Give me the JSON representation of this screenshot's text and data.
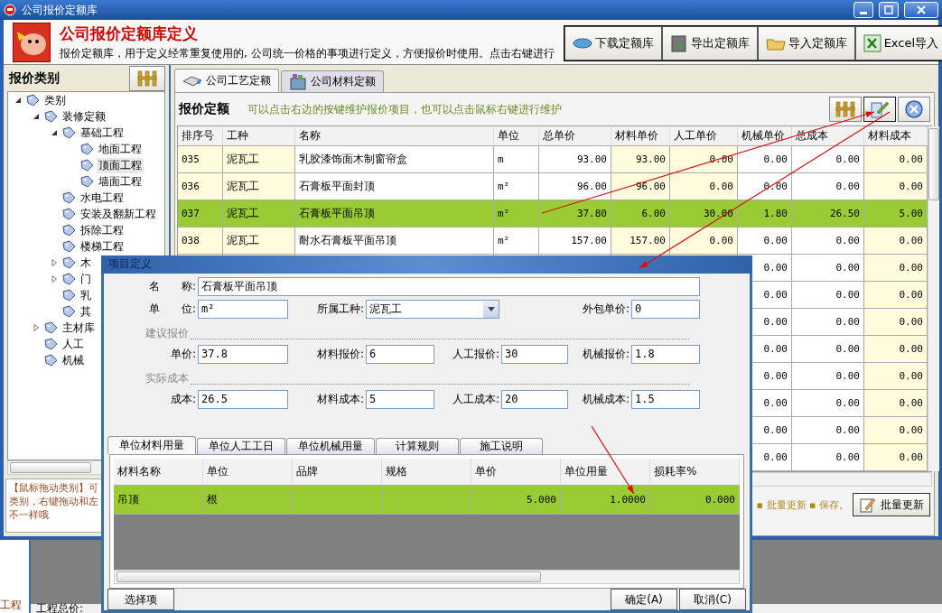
{
  "window": {
    "title": "公司报价定额库"
  },
  "header": {
    "title": "公司报价定额库定义",
    "description": "报价定额库，用于定义经常重复使用的, 公司统一价格的事项进行定义，方便报价时使用。点击右键进行",
    "buttons": [
      {
        "label": "下载定额库",
        "kind": "download"
      },
      {
        "label": "导出定额库",
        "kind": "export"
      },
      {
        "label": "导入定额库",
        "kind": "import"
      },
      {
        "label": "Excel导入",
        "kind": "excel"
      }
    ]
  },
  "sidebar": {
    "title": "报价类别",
    "tree": [
      {
        "label": "类别",
        "expanded": true,
        "selected": false,
        "children": [
          {
            "label": "装修定额",
            "expanded": true,
            "selected": false,
            "children": [
              {
                "label": "基础工程",
                "expanded": true,
                "selected": false,
                "children": [
                  {
                    "label": "地面工程",
                    "selected": false
                  },
                  {
                    "label": "顶面工程",
                    "selected": true
                  },
                  {
                    "label": "墙面工程",
                    "selected": false
                  }
                ]
              },
              {
                "label": "水电工程",
                "selected": false
              },
              {
                "label": "安装及翻新工程",
                "selected": false
              },
              {
                "label": "拆除工程",
                "selected": false
              },
              {
                "label": "楼梯工程",
                "selected": false
              },
              {
                "label": "木",
                "expanded": false,
                "selected": false
              },
              {
                "label": "门",
                "expanded": false,
                "selected": false
              },
              {
                "label": "乳",
                "selected": false
              },
              {
                "label": "其",
                "selected": false
              }
            ]
          },
          {
            "label": "主材库",
            "expanded": false,
            "selected": false
          },
          {
            "label": "人工",
            "selected": false
          },
          {
            "label": "机械",
            "selected": false
          }
        ]
      }
    ],
    "hint_lines": [
      "【鼠标拖动类别】可",
      "类别，右键拖动和左",
      "不一样哦"
    ]
  },
  "tabs": [
    {
      "label": "公司工艺定额",
      "selected": true,
      "kind": "process"
    },
    {
      "label": "公司材料定额",
      "selected": false,
      "kind": "material"
    }
  ],
  "panel": {
    "title": "报价定额",
    "hint": "可以点击右边的按键维护报价项目，也可以点击鼠标右键进行维护",
    "columns": [
      {
        "label": "排序号",
        "shaded": true
      },
      {
        "label": "工种",
        "shaded": true
      },
      {
        "label": "名称",
        "shaded": false
      },
      {
        "label": "单位",
        "shaded": false
      },
      {
        "label": "总单价",
        "shaded": false
      },
      {
        "label": "材料单价",
        "shaded": true
      },
      {
        "label": "人工单价",
        "shaded": true
      },
      {
        "label": "机械单价",
        "shaded": false
      },
      {
        "label": "总成本",
        "shaded": false
      },
      {
        "label": "材料成本",
        "shaded": true
      }
    ],
    "rows": [
      {
        "selected": false,
        "cells": [
          "035",
          "泥瓦工",
          "乳胶漆饰面木制窗帘盒",
          "m",
          "93.00",
          "93.00",
          "0.00",
          "0.00",
          "0.00",
          "0.00"
        ]
      },
      {
        "selected": false,
        "cells": [
          "036",
          "泥瓦工",
          "石膏板平面封顶",
          "m²",
          "96.00",
          "96.00",
          "0.00",
          "0.00",
          "0.00",
          "0.00"
        ]
      },
      {
        "selected": true,
        "cells": [
          "037",
          "泥瓦工",
          "石膏板平面吊顶",
          "m²",
          "37.80",
          "6.00",
          "30.00",
          "1.80",
          "26.50",
          "5.00"
        ]
      },
      {
        "selected": false,
        "cells": [
          "038",
          "泥瓦工",
          "耐水石膏板平面吊顶",
          "m²",
          "157.00",
          "157.00",
          "0.00",
          "0.00",
          "0.00",
          "0.00"
        ]
      }
    ],
    "partially_covered_rows": [
      [
        "0.00",
        "0.00",
        "0.00"
      ],
      [
        "0.00",
        "0.00",
        "0.00"
      ],
      [
        "0.00",
        "0.00",
        "0.00"
      ],
      [
        "0.00",
        "0.00",
        "0.00"
      ],
      [
        "0.00",
        "0.00",
        "0.00"
      ],
      [
        "0.00",
        "0.00",
        "0.00"
      ],
      [
        "0.00",
        "0.00",
        "0.00"
      ],
      [
        "0.00",
        "0.00",
        "0.00"
      ]
    ],
    "footer_note": "▪ 批量更新 ▪ 保存。",
    "batch_button": "批量更新"
  },
  "background_app": {
    "labels": [
      "工程",
      "工程总价:"
    ]
  },
  "dialog": {
    "title": "项目定义",
    "name": {
      "label": "名　　称:",
      "value": "石膏板平面吊顶"
    },
    "unit": {
      "label": "单　　位:",
      "value": "m²"
    },
    "trade": {
      "label": "所属工种:",
      "value": "泥瓦工"
    },
    "outsource": {
      "label": "外包单价:",
      "value": "0"
    },
    "sections": [
      {
        "title": "建议报价",
        "fields": [
          {
            "label": "单价:",
            "value": "37.8"
          },
          {
            "label": "材料报价:",
            "value": "6"
          },
          {
            "label": "人工报价:",
            "value": "30"
          },
          {
            "label": "机械报价:",
            "value": "1.8"
          }
        ]
      },
      {
        "title": "实际成本",
        "fields": [
          {
            "label": "成本:",
            "value": "26.5"
          },
          {
            "label": "材料成本:",
            "value": "5"
          },
          {
            "label": "人工成本:",
            "value": "20"
          },
          {
            "label": "机械成本:",
            "value": "1.5"
          }
        ]
      }
    ],
    "tabs": [
      {
        "label": "单位材料用量",
        "selected": true
      },
      {
        "label": "单位人工工日",
        "selected": false
      },
      {
        "label": "单位机械用量",
        "selected": false
      },
      {
        "label": "计算规则",
        "selected": false
      },
      {
        "label": "施工说明",
        "selected": false
      }
    ],
    "grid": {
      "columns": [
        "材料名称",
        "单位",
        "品牌",
        "规格",
        "单价",
        "单位用量",
        "损耗率%"
      ],
      "rows": [
        {
          "selected": true,
          "cells": [
            "吊顶",
            "根",
            "",
            "",
            "5.000",
            "1.0000",
            "0.000"
          ]
        }
      ]
    },
    "buttons": [
      "选择项",
      "确定(A)",
      "取消(C)"
    ]
  }
}
